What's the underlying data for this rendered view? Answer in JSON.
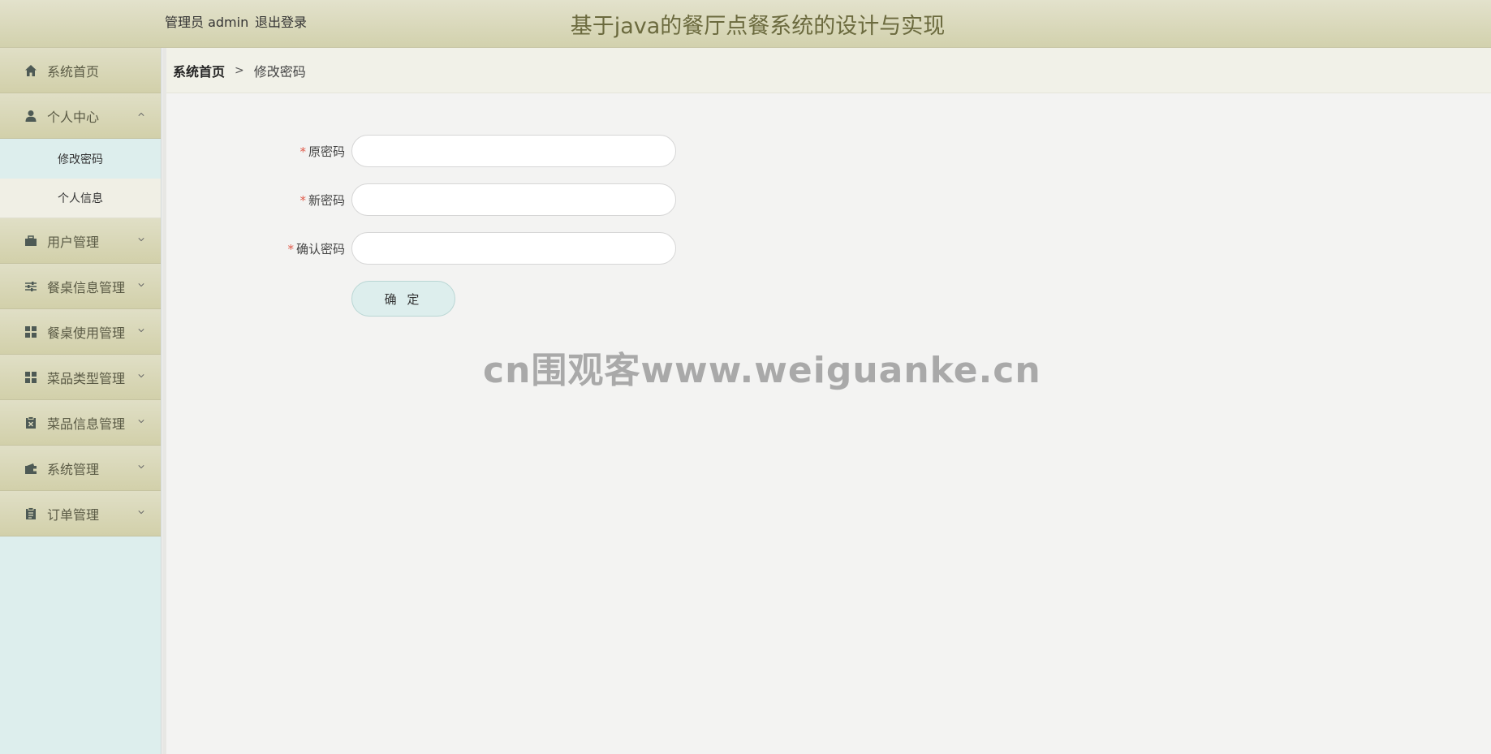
{
  "header": {
    "user_text": "管理员 admin",
    "logout_label": "退出登录",
    "title": "基于java的餐厅点餐系统的设计与实现"
  },
  "sidebar": {
    "items": [
      {
        "label": "系统首页",
        "icon": "home-icon"
      },
      {
        "label": "个人中心",
        "icon": "user-icon",
        "expanded": true,
        "children": [
          {
            "label": "修改密码",
            "active": true
          },
          {
            "label": "个人信息",
            "active": false
          }
        ]
      },
      {
        "label": "用户管理",
        "icon": "briefcase-icon"
      },
      {
        "label": "餐桌信息管理",
        "icon": "sliders-icon"
      },
      {
        "label": "餐桌使用管理",
        "icon": "grid-icon"
      },
      {
        "label": "菜品类型管理",
        "icon": "grid-icon"
      },
      {
        "label": "菜品信息管理",
        "icon": "clipboard-x-icon"
      },
      {
        "label": "系统管理",
        "icon": "wallet-icon"
      },
      {
        "label": "订单管理",
        "icon": "clipboard-icon"
      }
    ]
  },
  "breadcrumb": {
    "home": "系统首页",
    "separator": ">",
    "current": "修改密码"
  },
  "form": {
    "required_mark": "*",
    "fields": [
      {
        "label": "原密码",
        "value": "",
        "placeholder": ""
      },
      {
        "label": "新密码",
        "value": "",
        "placeholder": ""
      },
      {
        "label": "确认密码",
        "value": "",
        "placeholder": ""
      }
    ],
    "submit_label": "确 定"
  },
  "watermark": "cn围观客www.weiguanke.cn",
  "colors": {
    "header_bg": "#d8d7b8",
    "title_color": "#6b6a3e",
    "sidebar_bg": "#ddeeed",
    "button_bg": "#ddeeed",
    "required": "#e05a4a"
  }
}
